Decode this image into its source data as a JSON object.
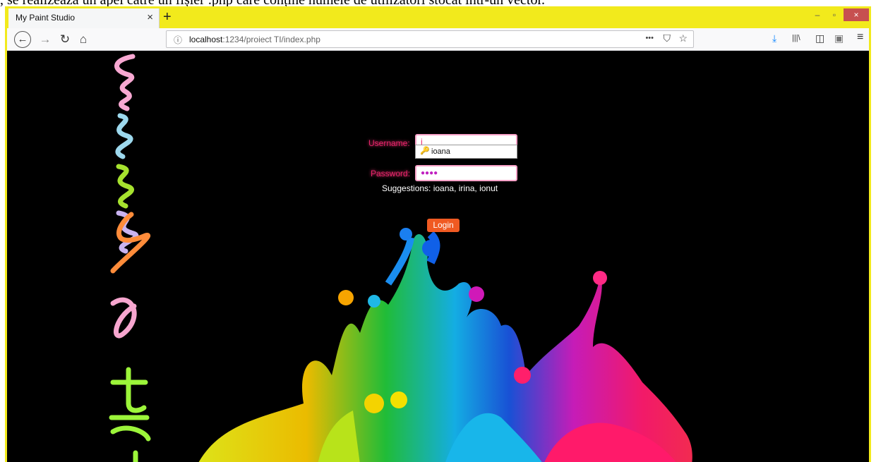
{
  "document_line": ", se realizează un apel către un fișier .php care conține numele de utilizatori stocat într-un vector.",
  "browser": {
    "tab_title": "My Paint Studio",
    "tab_close": "×",
    "new_tab": "+",
    "win_min": "–",
    "win_max": "▫",
    "win_close": "×",
    "url_info": "ⓘ",
    "url_host": "localhost",
    "url_path": ":1234/proiect TI/index.php",
    "url_more": "•••",
    "url_pocket": "⛉",
    "url_star": "☆",
    "back": "←",
    "forward": "→",
    "reload": "↻",
    "home": "⌂",
    "tool_download": "⤓",
    "tool_library": "|||\\",
    "tool_sidebar": "◫",
    "tool_extension": "▣",
    "tool_menu": "≡"
  },
  "login": {
    "username_label": "Username:",
    "username_value": "i",
    "autocomplete_icon": "🔑",
    "autocomplete_item": "ioana",
    "password_label": "Password:",
    "password_value": "●●●●",
    "suggestions": "Suggestions: ioana, irina, ionut",
    "login_button": "Login"
  },
  "colors": {
    "frame_border": "#f2ea1c",
    "label_color": "#e8246b",
    "button_color": "#f05a22"
  }
}
